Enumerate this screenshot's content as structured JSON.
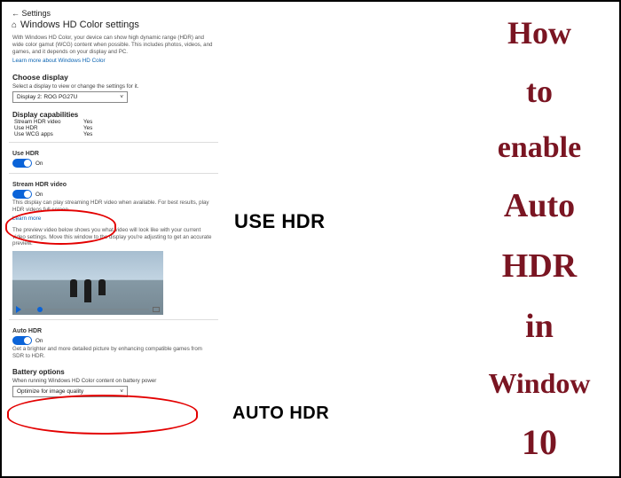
{
  "header": {
    "back_label": "Settings",
    "page_title": "Windows HD Color settings"
  },
  "intro": {
    "description": "With Windows HD Color, your device can show high dynamic range (HDR) and wide color gamut (WCG) content when possible. This includes photos, videos, and games, and it depends on your display and PC.",
    "learn_more": "Learn more about Windows HD Color"
  },
  "choose_display": {
    "heading": "Choose display",
    "instruction": "Select a display to view or change the settings for it.",
    "selected": "Display 2: ROG PG27U"
  },
  "capabilities": {
    "heading": "Display capabilities",
    "rows": [
      {
        "label": "Stream HDR video",
        "value": "Yes"
      },
      {
        "label": "Use HDR",
        "value": "Yes"
      },
      {
        "label": "Use WCG apps",
        "value": "Yes"
      }
    ]
  },
  "use_hdr": {
    "heading": "Use HDR",
    "state": "On"
  },
  "stream_hdr": {
    "heading": "Stream HDR video",
    "state": "On",
    "note": "This display can play streaming HDR video when available. For best results, play HDR videos full screen.",
    "learn_more": "Learn more",
    "preview_note": "The preview video below shows you what video will look like with your current video settings. Move this window to the display you're adjusting to get an accurate preview."
  },
  "auto_hdr": {
    "heading": "Auto HDR",
    "state": "On",
    "note": "Get a brighter and more detailed picture by enhancing compatible games from SDR to HDR."
  },
  "battery": {
    "heading": "Battery options",
    "instruction": "When running Windows HD Color content on battery power",
    "selected": "Optimize for image quality"
  },
  "callouts": {
    "use": "USE HDR",
    "auto": "AUTO HDR"
  },
  "title_words": [
    "How",
    "to",
    "enable",
    "Auto",
    "HDR",
    "in",
    "Window",
    "10"
  ]
}
